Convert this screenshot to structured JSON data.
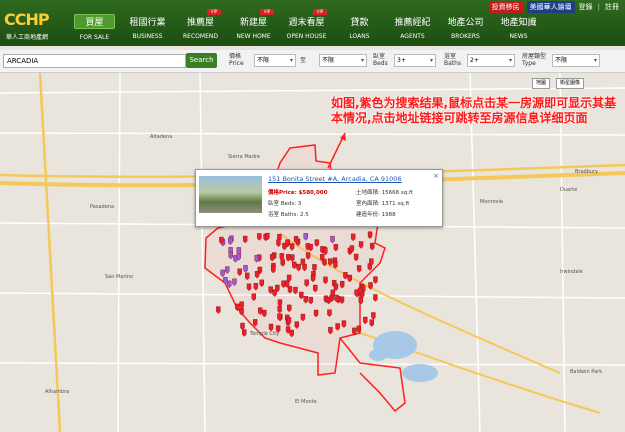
{
  "logo": {
    "text": "CCHP",
    "sub": "華人工商地產網"
  },
  "topright": {
    "tag1": "投資移民",
    "tag2": "美國華人論壇",
    "login": "登錄",
    "register": "註冊"
  },
  "nav": [
    {
      "cn": "買屋",
      "en": "FOR SALE",
      "active": true
    },
    {
      "cn": "租國行業",
      "en": "BUSINESS"
    },
    {
      "cn": "推薦屋",
      "en": "RECOMEND",
      "vip": true
    },
    {
      "cn": "新建屋",
      "en": "NEW HOME",
      "vip": true
    },
    {
      "cn": "週末看屋",
      "en": "OPEN HOUSE",
      "vip": true
    },
    {
      "cn": "貸款",
      "en": "LOANS"
    },
    {
      "cn": "推薦經紀",
      "en": "AGENTS"
    },
    {
      "cn": "地產公司",
      "en": "BROKERS"
    },
    {
      "cn": "地產知識",
      "en": "NEWS"
    }
  ],
  "vip_label": "VIP",
  "search": {
    "value": "ARCADIA",
    "button": "Search"
  },
  "filters": {
    "price_label": "價格",
    "price_sub": "Price",
    "min": "不限",
    "to": "至",
    "max": "不限",
    "beds_label": "臥室",
    "beds_sub": "Beds",
    "beds": "3+",
    "baths_label": "浴室",
    "baths_sub": "Baths",
    "baths": "2+",
    "type_label": "房屋類型",
    "type_sub": "Type",
    "type": "不限"
  },
  "map_buttons": {
    "map": "地圖",
    "satellite": "衛星圖像"
  },
  "annotation": "如图,紫色为搜索结果,鼠标点击某一房源即可显示其基本情况,点击地址链接可跳转至房源信息详细页面",
  "popup": {
    "address": "151 Bonita Street #A, Arcadia, CA 91006",
    "price_label": "價格Price:",
    "price": "$580,000",
    "beds": "臥室 Beds: 3",
    "baths": "浴室 Baths: 2.5",
    "lot": "土地面積: 15668 sq.ft",
    "interior": "室內面積: 1371 sq.ft",
    "year": "建造年份: 1988",
    "close": "×"
  },
  "map_labels": [
    "Sierra Madre",
    "Altadena",
    "San Marino",
    "Temple City",
    "Monrovia",
    "Duarte",
    "Bradbury",
    "Alhambra",
    "El Monte",
    "Baldwin Park",
    "Irwindale",
    "Pasadena"
  ],
  "colors": {
    "header": "#2f6b1f",
    "boundary": "#ff2020",
    "marker_red": "#e8202a",
    "marker_purple": "#9b5bd5",
    "water": "#a8c8e8"
  }
}
